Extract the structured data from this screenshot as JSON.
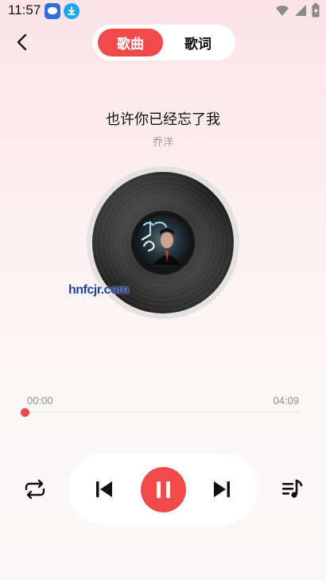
{
  "status_bar": {
    "time": "11:57",
    "icons": [
      "app-icon",
      "download-icon",
      "wifi-icon",
      "signal-icon",
      "battery-icon"
    ]
  },
  "header": {
    "tabs": [
      {
        "label": "歌曲",
        "active": true
      },
      {
        "label": "歌词",
        "active": false
      }
    ]
  },
  "song": {
    "title": "也许你已经忘了我",
    "artist": "乔洋"
  },
  "watermark": "hnfcjr.com",
  "progress": {
    "current": "00:00",
    "total": "04:09",
    "fraction": 0.0
  },
  "controls": [
    "repeat-icon",
    "previous-icon",
    "pause-icon",
    "next-icon",
    "playlist-icon"
  ],
  "colors": {
    "accent": "#f24a4c",
    "background_top": "#fbe3e6",
    "background_bottom": "#f9f7f7"
  }
}
